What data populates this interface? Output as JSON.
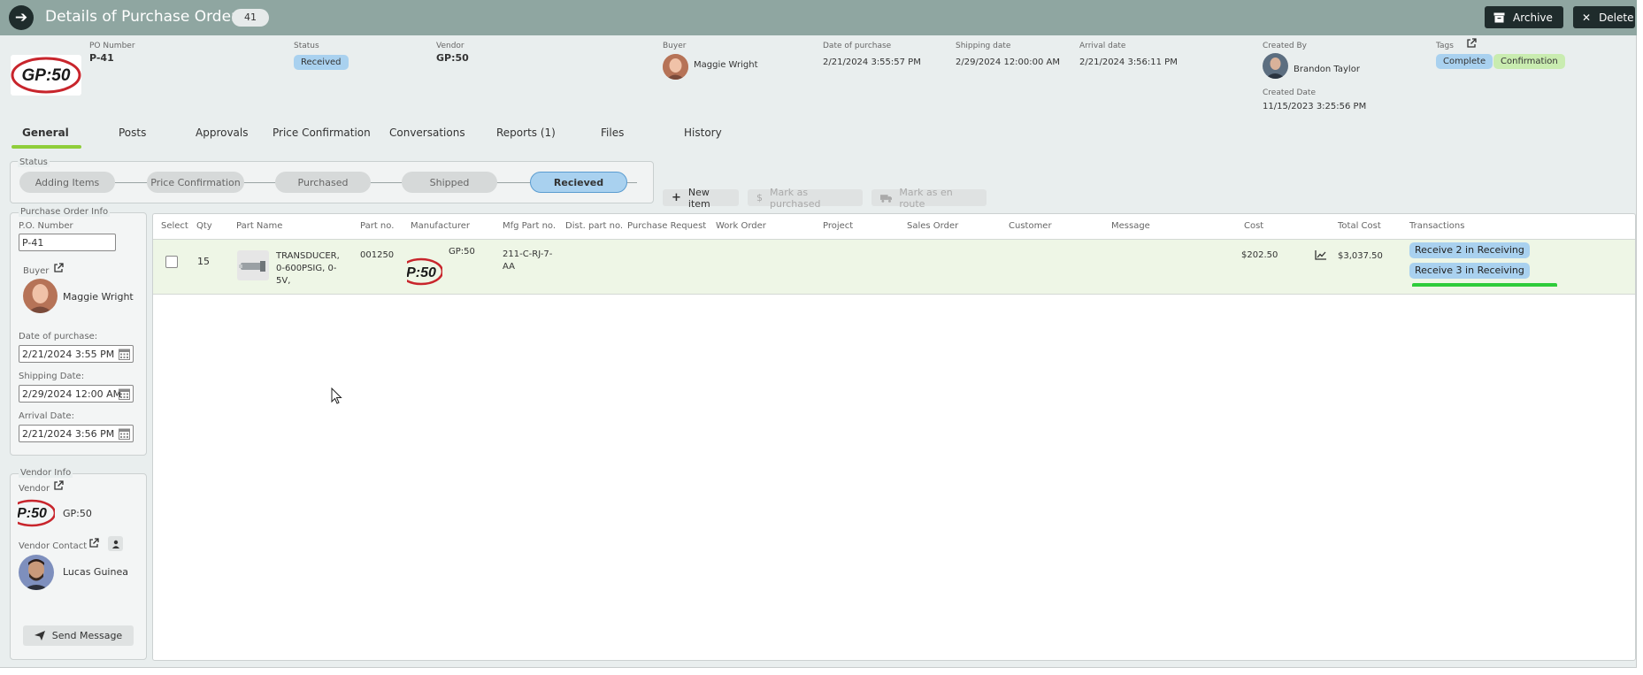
{
  "header": {
    "title": "Details of Purchase Order",
    "count_badge": "41",
    "archive_label": "Archive",
    "delete_label": "Delete"
  },
  "info": {
    "po_number_label": "PO Number",
    "po_number": "P-41",
    "status_label": "Status",
    "status": "Received",
    "vendor_label": "Vendor",
    "vendor": "GP:50",
    "buyer_label": "Buyer",
    "buyer": "Maggie Wright",
    "date_of_purchase_label": "Date of purchase",
    "date_of_purchase": "2/21/2024 3:55:57 PM",
    "shipping_date_label": "Shipping date",
    "shipping_date": "2/29/2024 12:00:00 AM",
    "arrival_date_label": "Arrival date",
    "arrival_date": "2/21/2024 3:56:11 PM",
    "created_by_label": "Created By",
    "created_by": "Brandon Taylor",
    "created_date_label": "Created Date",
    "created_date": "11/15/2023 3:25:56 PM",
    "tags_label": "Tags",
    "tags": [
      "Complete",
      "Confirmation"
    ],
    "logo_text": "GP:50"
  },
  "tabs": [
    "General",
    "Posts",
    "Approvals",
    "Price Confirmation",
    "Conversations",
    "Reports (1)",
    "Files",
    "History"
  ],
  "status_stepper": {
    "legend": "Status",
    "steps": [
      "Adding Items",
      "Price Confirmation",
      "Purchased",
      "Shipped",
      "Recieved"
    ]
  },
  "actions": {
    "new_item": "New item",
    "mark_purchased": "Mark as purchased",
    "mark_en_route": "Mark as en route"
  },
  "po_info": {
    "legend": "Purchase Order Info",
    "po_number_label": "P.O. Number",
    "po_number_value": "P-41",
    "buyer_label": "Buyer",
    "buyer_name": "Maggie Wright",
    "date_of_purchase_label": "Date of purchase:",
    "date_of_purchase_value": "2/21/2024 3:55 PM",
    "shipping_date_label": "Shipping Date:",
    "shipping_date_value": "2/29/2024 12:00 AM",
    "arrival_date_label": "Arrival Date:",
    "arrival_date_value": "2/21/2024 3:56 PM"
  },
  "vendor_info": {
    "legend": "Vendor Info",
    "vendor_label": "Vendor",
    "vendor_name": "GP:50",
    "vendor_logo_text": "P:50",
    "contact_label": "Vendor Contact",
    "contact_name": "Lucas Guinea",
    "send_message": "Send Message"
  },
  "table": {
    "columns": [
      "Select",
      "Qty",
      "Part Name",
      "Part no.",
      "Manufacturer",
      "Mfg Part no.",
      "Dist. part no.",
      "Purchase Request",
      "Work Order",
      "Project",
      "Sales Order",
      "Customer",
      "Message",
      "Cost",
      "Total Cost",
      "Transactions"
    ],
    "rows": [
      {
        "qty": "15",
        "part_name": "TRANSDUCER, 0-600PSIG, 0-5V,",
        "part_no": "001250",
        "manufacturer": "GP:50",
        "manufacturer_logo_text": "P:50",
        "mfg_part_no": "211-C-RJ-7-AA",
        "cost": "$202.50",
        "total_cost": "$3,037.50",
        "transactions": [
          "Receive 2 in Receiving",
          "Receive 3 in Receiving"
        ]
      }
    ]
  },
  "colors": {
    "titlebar": "#8fa6a1",
    "dark_button": "#1f2c2c",
    "active_tab_underline": "#8fce3a",
    "status_pill": "#a9d1ef",
    "tag_confirmation": "#c9ecb0",
    "row_highlight": "#eef6e6"
  }
}
